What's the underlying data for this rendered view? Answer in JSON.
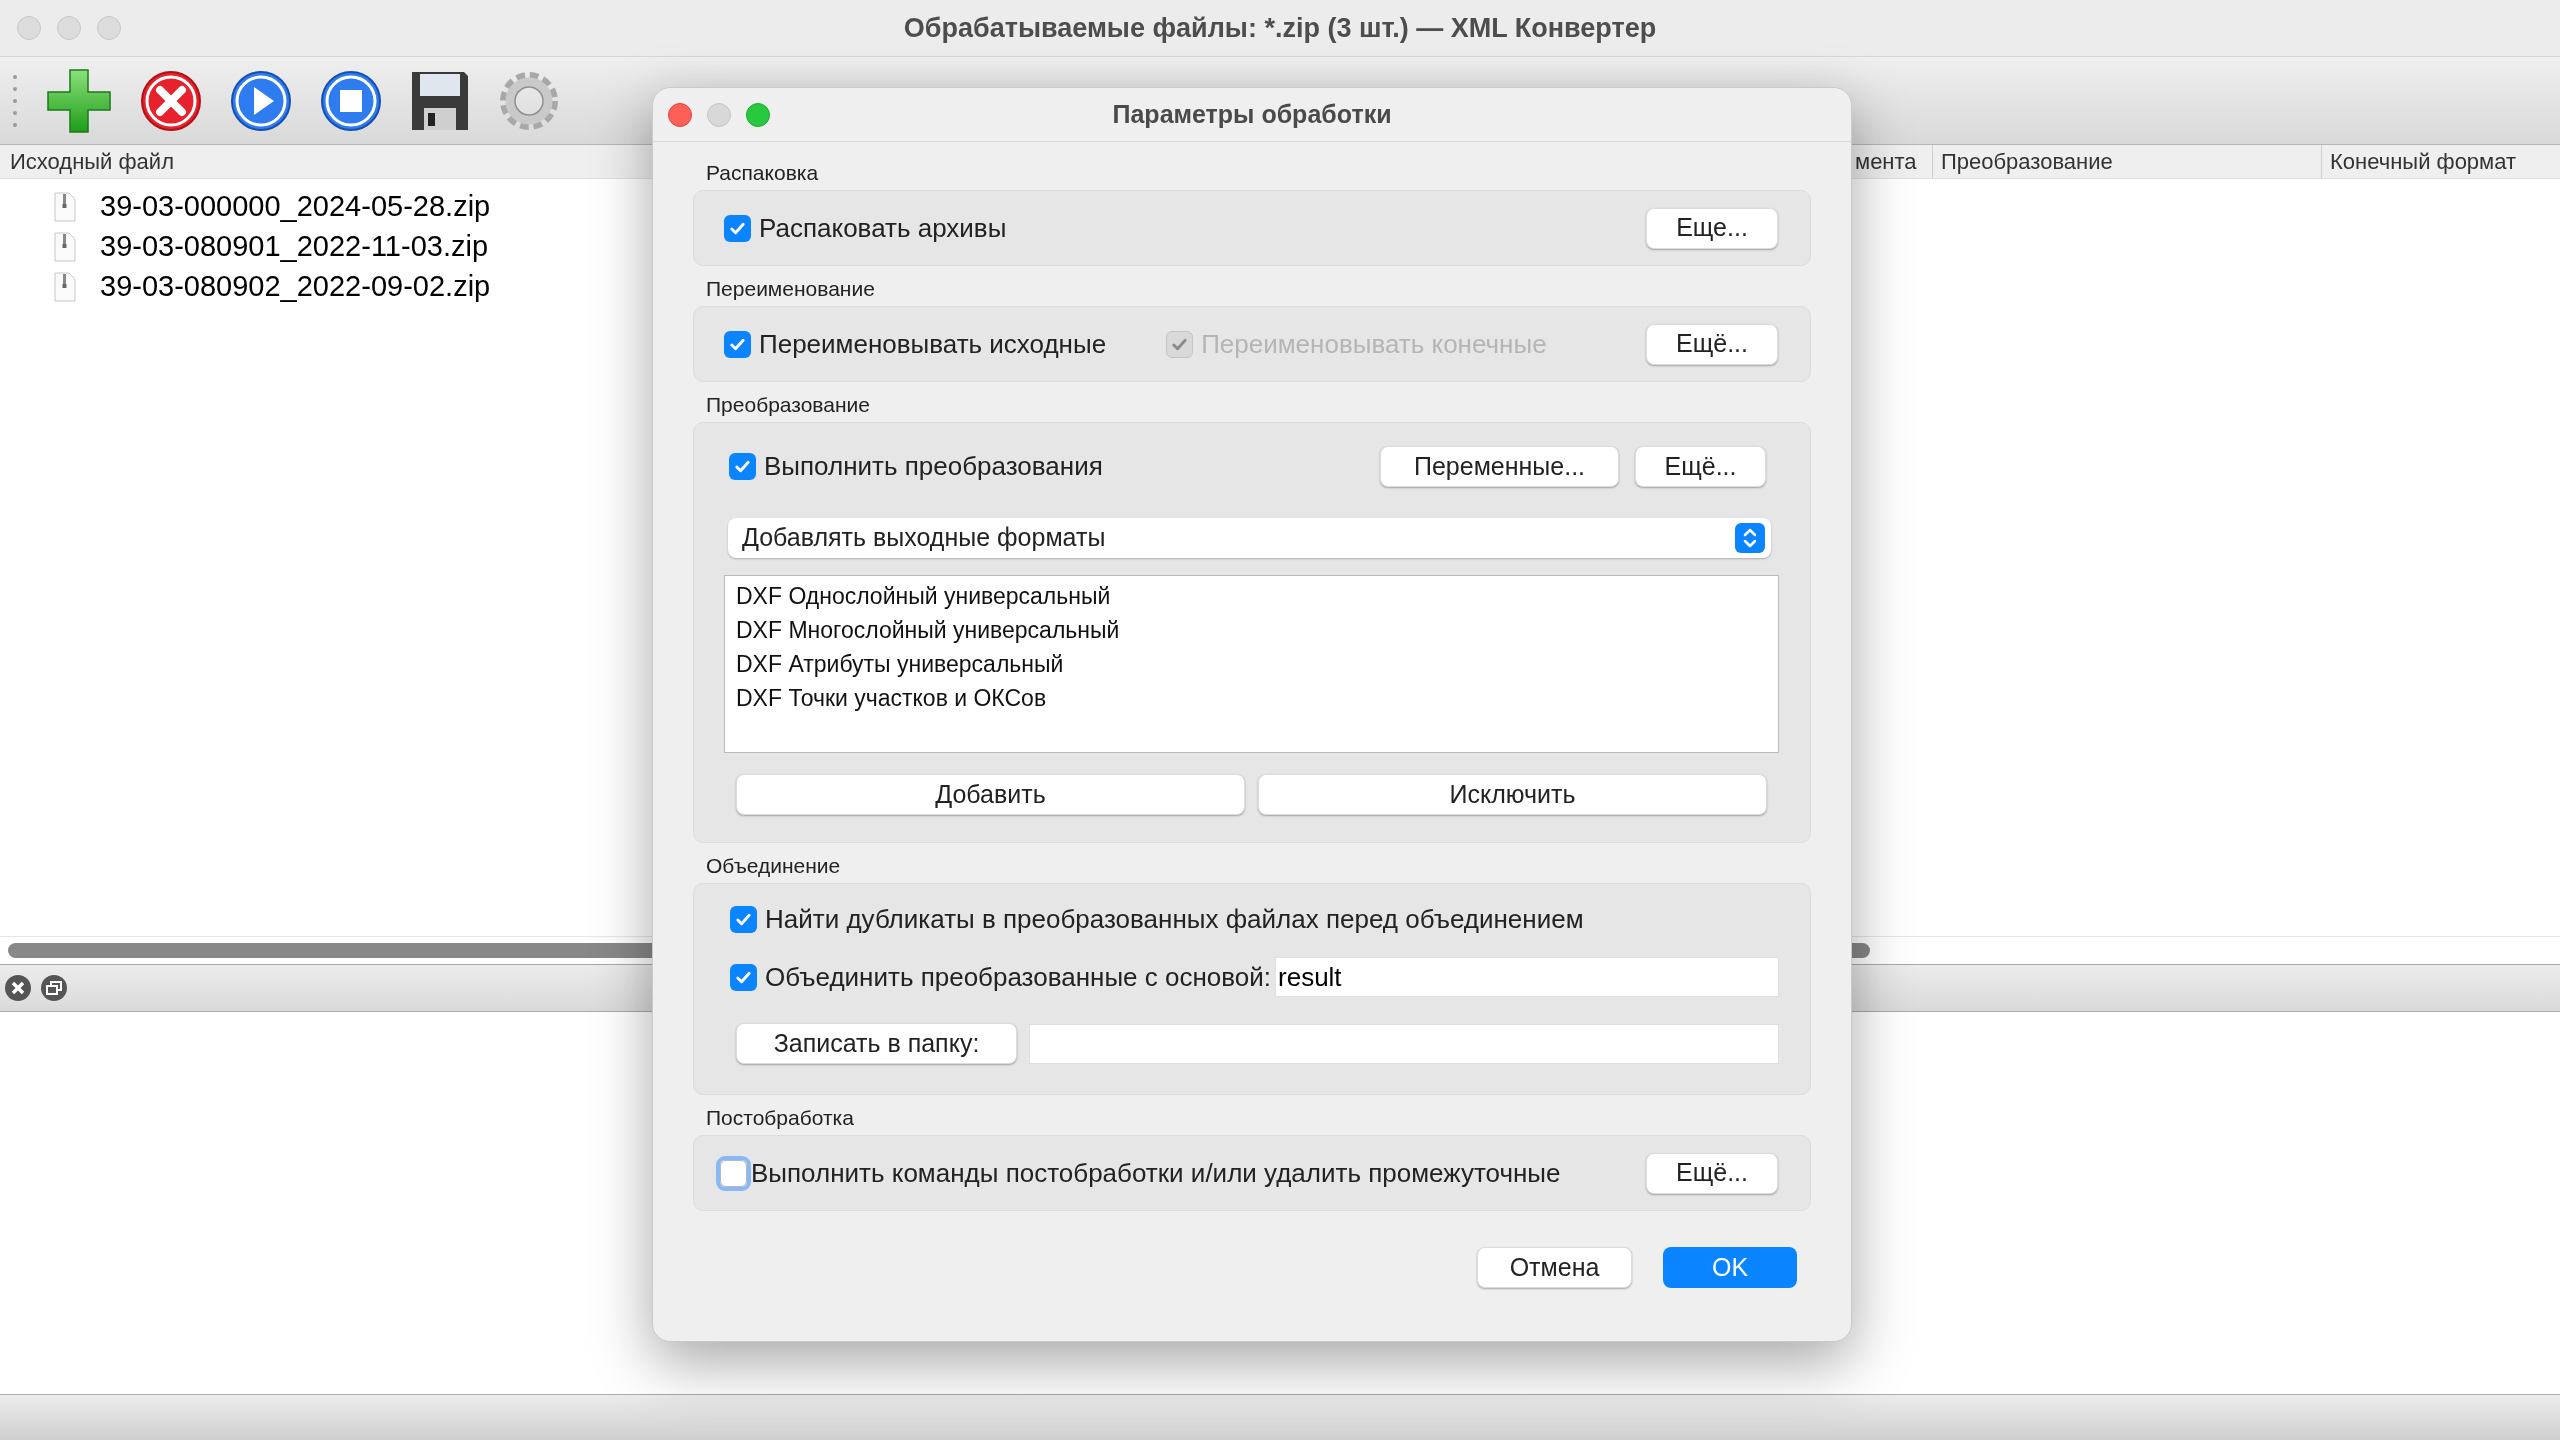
{
  "window": {
    "title": "Обрабатываемые файлы: *.zip (3 шт.) — XML Конвертер"
  },
  "table": {
    "columns": [
      {
        "label": "Исходный файл"
      },
      {
        "label": "мента"
      },
      {
        "label": "Преобразование"
      },
      {
        "label": "Конечный формат"
      }
    ],
    "rows": [
      {
        "file": "39-03-000000_2024-05-28.zip"
      },
      {
        "file": "39-03-080901_2022-11-03.zip"
      },
      {
        "file": "39-03-080902_2022-09-02.zip"
      }
    ]
  },
  "dialog": {
    "title": "Параметры обработки",
    "unpack": {
      "label": "Распаковка",
      "checkbox": {
        "label": "Распаковать архивы",
        "checked": true
      },
      "more_button": "Еще..."
    },
    "rename": {
      "label": "Переименование",
      "source": {
        "label": "Переименовывать исходные",
        "checked": true
      },
      "target": {
        "label": "Переименовывать конечные",
        "checked": true,
        "disabled": true
      },
      "more_button": "Ещё..."
    },
    "transform": {
      "label": "Преобразование",
      "checkbox": {
        "label": "Выполнить преобразования",
        "checked": true
      },
      "variables_button": "Переменные...",
      "more_button": "Ещё...",
      "mode_select": {
        "value": "Добавлять выходные форматы"
      },
      "formats": [
        "DXF Однослойный универсальный",
        "DXF Многослойный универсальный",
        "DXF Атрибуты универсальный",
        "DXF Точки участков и ОКСов"
      ],
      "add_button": "Добавить",
      "exclude_button": "Исключить"
    },
    "merge": {
      "label": "Объединение",
      "find_duplicates": {
        "label": "Найти дубликаты в преобразованных файлах перед объединением",
        "checked": true
      },
      "merge_base": {
        "label": "Объединить преобразованные с основой:",
        "checked": true
      },
      "base_field": {
        "value": "result"
      },
      "folder_button": "Записать в папку:"
    },
    "postprocess": {
      "label": "Постобработка",
      "checkbox": {
        "label": "Выполнить команды постобработки и/или удалить промежуточные",
        "checked": false,
        "focused": true
      },
      "more_button": "Ещё..."
    },
    "buttons": {
      "cancel": "Отмена",
      "ok": "OK"
    }
  }
}
